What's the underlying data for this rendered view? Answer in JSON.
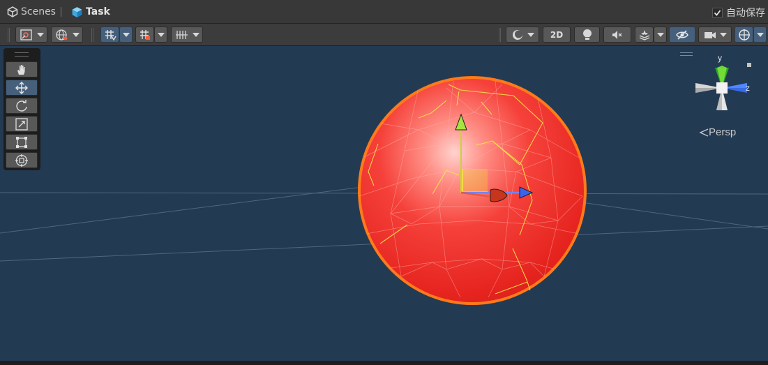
{
  "header": {
    "scenes_label": "Scenes",
    "task_label": "Task",
    "autosave_label": "自动保存",
    "autosave_checked": true
  },
  "toolbar": {
    "left_buttons": [
      "draw-mode",
      "global-local",
      "grid-snap",
      "increment-snap",
      "grid-visibility"
    ],
    "right_buttons": [
      "shading-mode",
      "2d-toggle",
      "lighting-toggle",
      "audio-toggle",
      "effects",
      "scene-visibility",
      "camera-settings",
      "gizmos"
    ],
    "2d_label": "2D"
  },
  "tools": {
    "items": [
      {
        "name": "view-tool",
        "icon": "hand-icon",
        "active": false
      },
      {
        "name": "move-tool",
        "icon": "move-arrows-icon",
        "active": true
      },
      {
        "name": "rotate-tool",
        "icon": "rotate-icon",
        "active": false
      },
      {
        "name": "scale-tool",
        "icon": "scale-icon",
        "active": false
      },
      {
        "name": "rect-tool",
        "icon": "rect-transform-icon",
        "active": false
      },
      {
        "name": "transform-tool",
        "icon": "transform-icon",
        "active": false
      }
    ]
  },
  "scene": {
    "background_color": "#233a53",
    "sphere_color": "#f0332d",
    "outline_color": "#ff8a1f",
    "selected_object": "sphere"
  },
  "orientation_gizmo": {
    "y_label": "y",
    "z_label": "z",
    "projection_label": "Persp"
  },
  "colors": {
    "x_axis": "#d8331f",
    "y_axis": "#9be033",
    "z_axis": "#3a6cf0",
    "toggle_active": "#46607c"
  }
}
